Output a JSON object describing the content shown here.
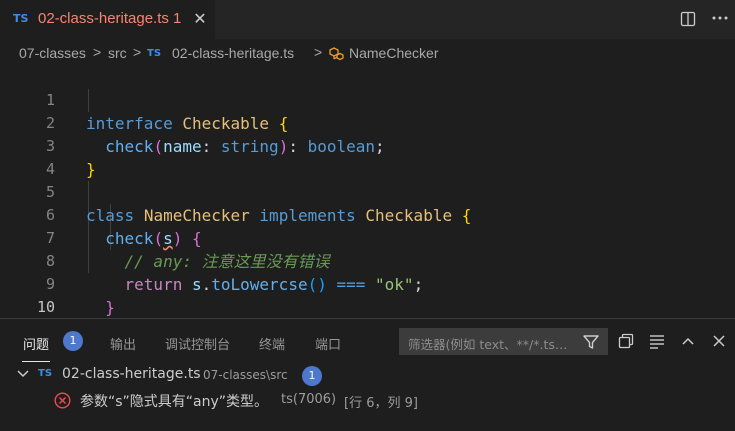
{
  "tab": {
    "lang_badge": "TS",
    "file_name": "02-class-heritage.ts 1",
    "close_glyph": "✕"
  },
  "breadcrumb": {
    "folder": "07-classes",
    "subfolder": "src",
    "lang_badge": "TS",
    "file": "02-class-heritage.ts",
    "symbol": "NameChecker",
    "separator": ">"
  },
  "editor": {
    "active_line": 10,
    "lines": [
      {
        "n": "1"
      },
      {
        "n": "2"
      },
      {
        "n": "3"
      },
      {
        "n": "4"
      },
      {
        "n": "5"
      },
      {
        "n": "6"
      },
      {
        "n": "7"
      },
      {
        "n": "8"
      },
      {
        "n": "9"
      },
      {
        "n": "10"
      }
    ],
    "tokens": {
      "kw_interface": "interface",
      "iface_name": "Checkable",
      "open_brace": "{",
      "close_brace": "}",
      "method": "check",
      "paren_open": "(",
      "param": "name",
      "colon": ":",
      "type_string": "string",
      "paren_close": ")",
      "return_colon": ":",
      "type_boolean": "boolean",
      "semicolon": ";",
      "kw_class": "class",
      "class_name": "NameChecker",
      "kw_implements": "implements",
      "impl_name": "Checkable",
      "param_s": "s",
      "comment": "// any: 注意这里没有错误",
      "kw_return": "return",
      "obj_s": "s",
      "dot": ".",
      "call": "toLowercse",
      "call_parens": "()",
      "op_eq": "===",
      "str_ok": "\"ok\"",
      "end_semicolon": ";"
    }
  },
  "panel": {
    "tabs": [
      {
        "label": "问题",
        "active": true
      },
      {
        "label": "输出"
      },
      {
        "label": "调试控制台"
      },
      {
        "label": "终端"
      },
      {
        "label": "端口"
      }
    ],
    "problems_count": "1",
    "filter_placeholder": "筛选器(例如 text、**/*.ts…",
    "file_group": {
      "lang_badge": "TS",
      "file": "02-class-heritage.ts",
      "path": "07-classes\\src",
      "count": "1"
    },
    "problem": {
      "message": "参数“s”隐式具有“any”类型。",
      "code": "ts(7006)",
      "location": "[行 6，列 9]"
    }
  },
  "colors": {
    "editor_bg": "#1e1e1e",
    "tab_error_text": "#f48771",
    "ts_badge": "#3b8eea",
    "badge_bg": "#4d78cc",
    "error_icon": "#f14c4c"
  }
}
